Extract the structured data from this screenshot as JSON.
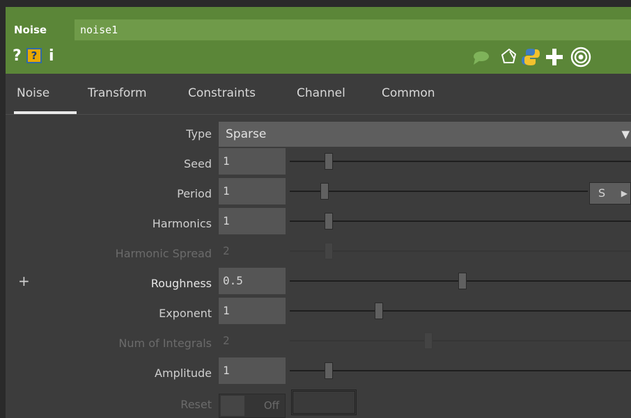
{
  "header": {
    "op_type": "Noise",
    "op_name": "noise1",
    "help_icons": [
      "question-icon",
      "python-help-icon",
      "info-icon"
    ],
    "action_icons": [
      "comment-icon",
      "edit-icon",
      "python-icon",
      "add-icon",
      "viewer-icon"
    ]
  },
  "tabs": [
    "Noise",
    "Transform",
    "Constraints",
    "Channel",
    "Common"
  ],
  "active_tab": "Noise",
  "params": {
    "type": {
      "label": "Type",
      "value": "Sparse"
    },
    "seed": {
      "label": "Seed",
      "value": "1"
    },
    "period": {
      "label": "Period",
      "value": "1",
      "units_button": "S"
    },
    "harmonics": {
      "label": "Harmonics",
      "value": "1"
    },
    "harmonic_spread": {
      "label": "Harmonic Spread",
      "value": "2"
    },
    "roughness": {
      "label": "Roughness",
      "value": "0.5"
    },
    "exponent": {
      "label": "Exponent",
      "value": "1"
    },
    "num_integrals": {
      "label": "Num of Integrals",
      "value": "2"
    },
    "amplitude": {
      "label": "Amplitude",
      "value": "1"
    },
    "reset": {
      "label": "Reset",
      "value": "Off"
    }
  },
  "colors": {
    "header_green": "#5b8638",
    "name_field_green": "#6f9a49",
    "panel_bg": "#3c3c3c"
  }
}
